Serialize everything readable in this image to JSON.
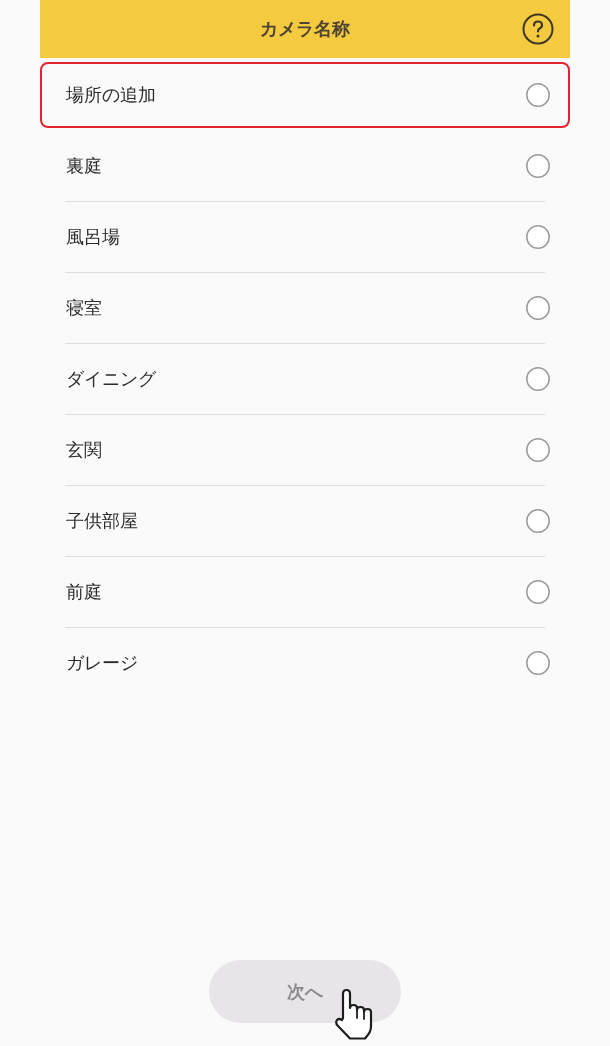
{
  "header": {
    "title": "カメラ名称"
  },
  "locations": [
    {
      "label": "場所の追加",
      "selected": false,
      "highlighted": true
    },
    {
      "label": "裏庭",
      "selected": false,
      "highlighted": false
    },
    {
      "label": "風呂場",
      "selected": false,
      "highlighted": false
    },
    {
      "label": "寝室",
      "selected": false,
      "highlighted": false
    },
    {
      "label": "ダイニング",
      "selected": false,
      "highlighted": false
    },
    {
      "label": "玄関",
      "selected": false,
      "highlighted": false
    },
    {
      "label": "子供部屋",
      "selected": false,
      "highlighted": false
    },
    {
      "label": "前庭",
      "selected": false,
      "highlighted": false
    },
    {
      "label": "ガレージ",
      "selected": false,
      "highlighted": false
    }
  ],
  "next_button": {
    "label": "次へ",
    "disabled": true
  }
}
